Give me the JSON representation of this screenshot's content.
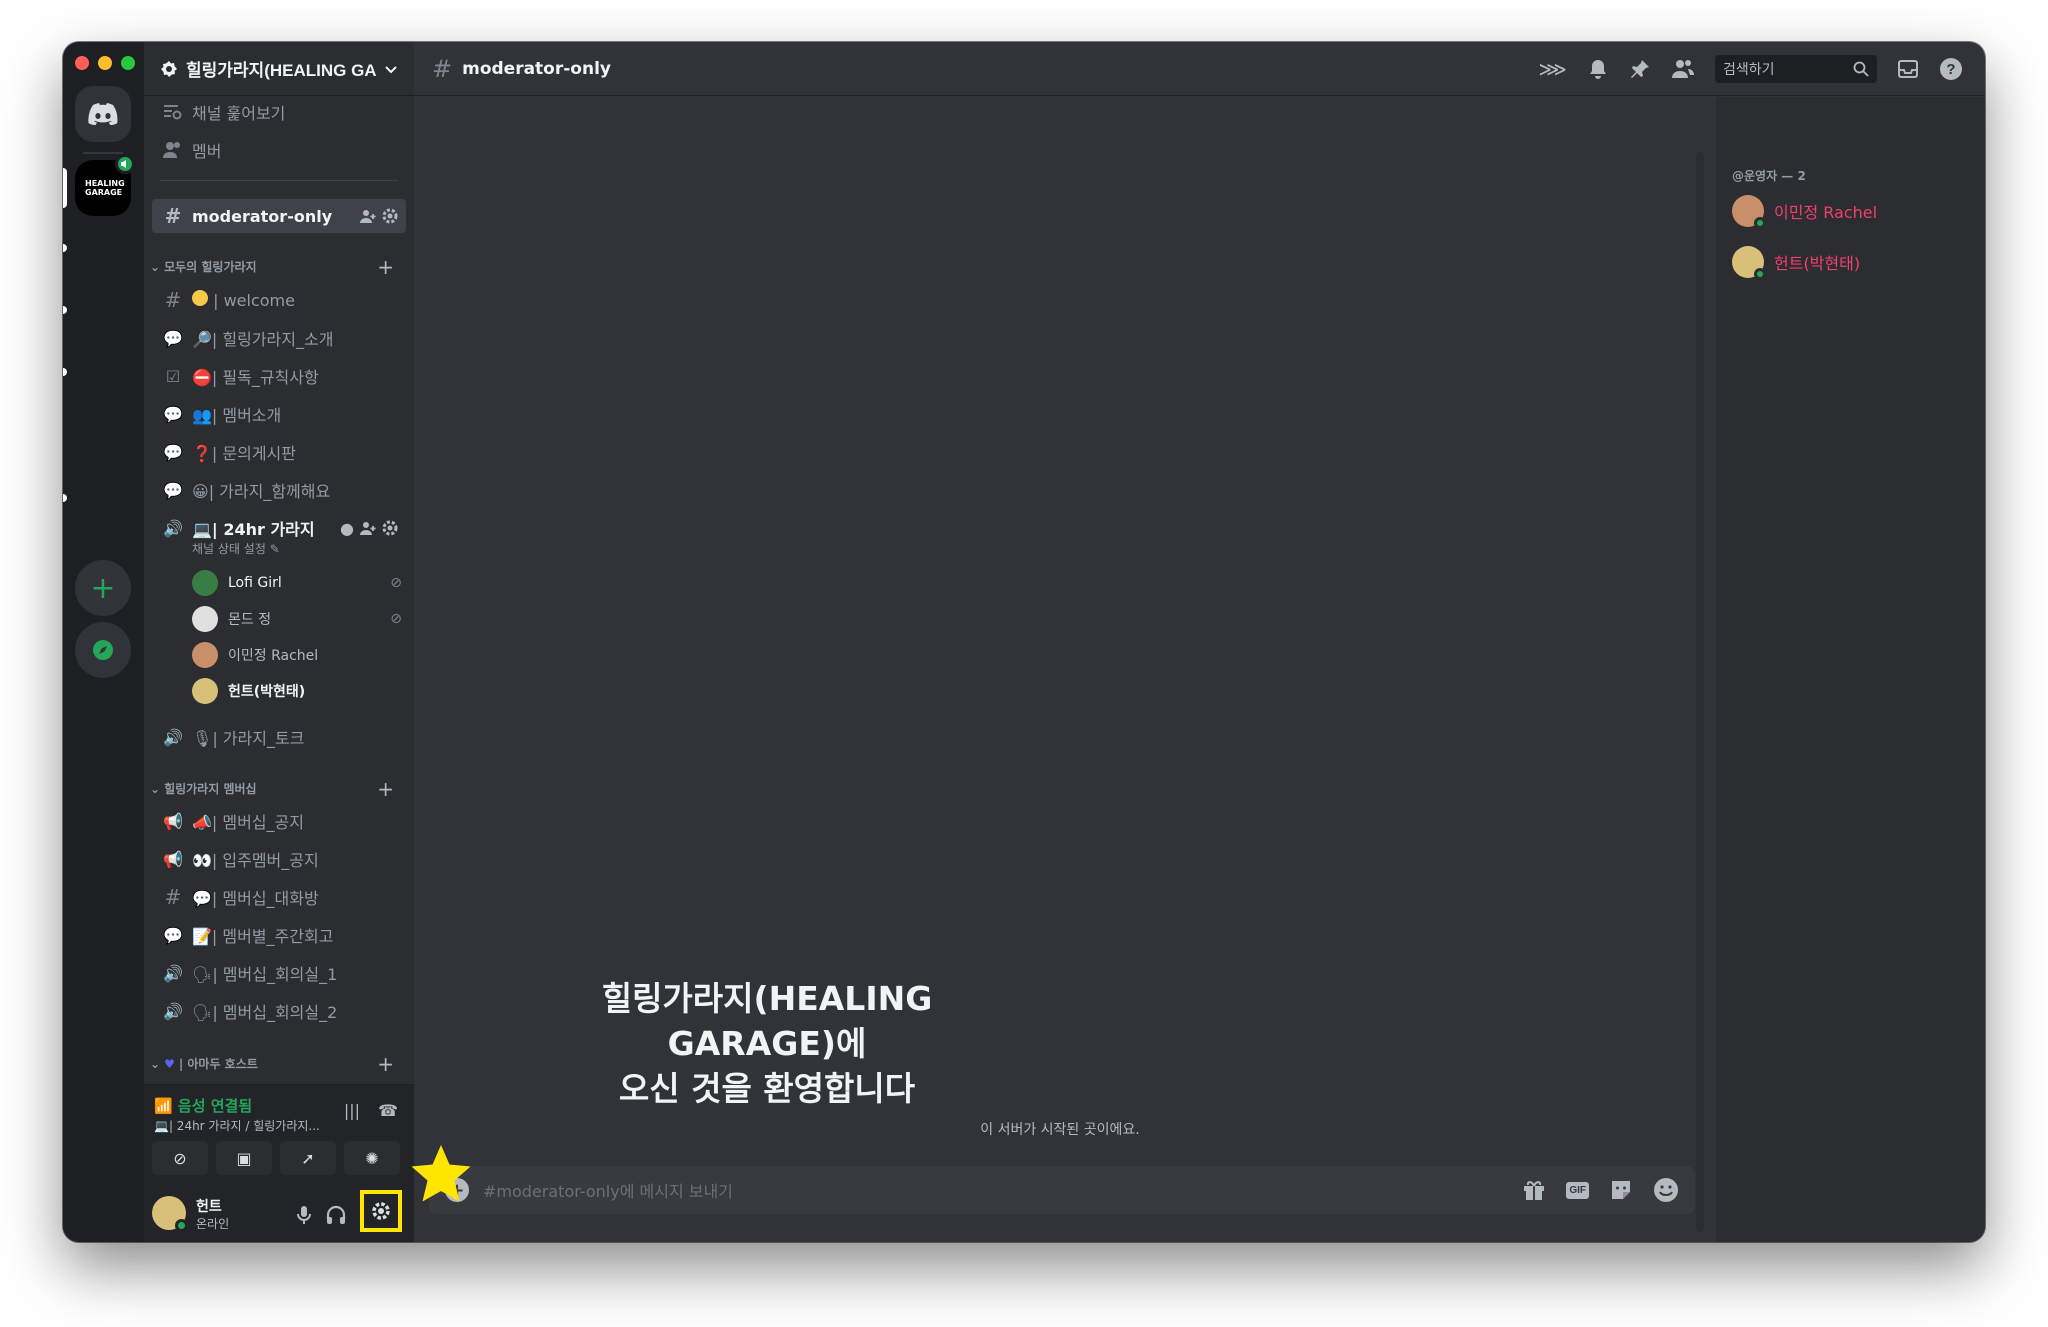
{
  "server": {
    "name": "힐링가라지(HEALING GARAGE)",
    "icon_text": "HEALING GARAGE"
  },
  "nav": {
    "browse_channels": "채널 훑어보기",
    "members": "멤버"
  },
  "channels": {
    "moderator_only": "moderator-only",
    "category_1": "모두의 힐링가라지",
    "cat1_items": [
      "| welcome",
      "| 힐링가라지_소개",
      "| 필독_규칙사항",
      "| 멤버소개",
      "| 문의게시판",
      "| 가라지_함께해요",
      "| 24hr 가라지",
      "| 가라지_토크"
    ],
    "voice_status_line": "채널 상태 설정",
    "voice_users": [
      "Lofi Girl",
      "몬드 정",
      "이민정 Rachel",
      "헌트(박현태)"
    ],
    "category_2": "힐링가라지 멤버십",
    "cat2_items": [
      "| 멤버십_공지",
      "| 입주멤버_공지",
      "| 멤버십_대화방",
      "| 멤버별_주간회고",
      "| 멤버십_회의실_1",
      "| 멤버십_회의실_2"
    ],
    "category_3": "| 아마두 호스트"
  },
  "voice_panel": {
    "status": "음성 연결됨",
    "location": "| 24hr 가라지 / 힐링가라지..."
  },
  "user": {
    "name": "헌트",
    "status": "온라인"
  },
  "topbar": {
    "channel": "moderator-only",
    "search_placeholder": "검색하기"
  },
  "welcome": {
    "title_line1": "힐링가라지(HEALING",
    "title_line2": "GARAGE)에",
    "title_line3": "오신 것을 환영합니다",
    "subtitle": "이 서버가 시작된 곳이에요."
  },
  "composer": {
    "placeholder": "#moderator-only에 메시지 보내기",
    "gif_label": "GIF"
  },
  "member_list": {
    "category": "@운영자 — 2",
    "members": [
      "이민정 Rachel",
      "헌트(박현태)"
    ]
  },
  "colors": {
    "accent_green": "#23a55a",
    "role_pink": "#f23f6d",
    "highlight_yellow": "#ffe600"
  }
}
